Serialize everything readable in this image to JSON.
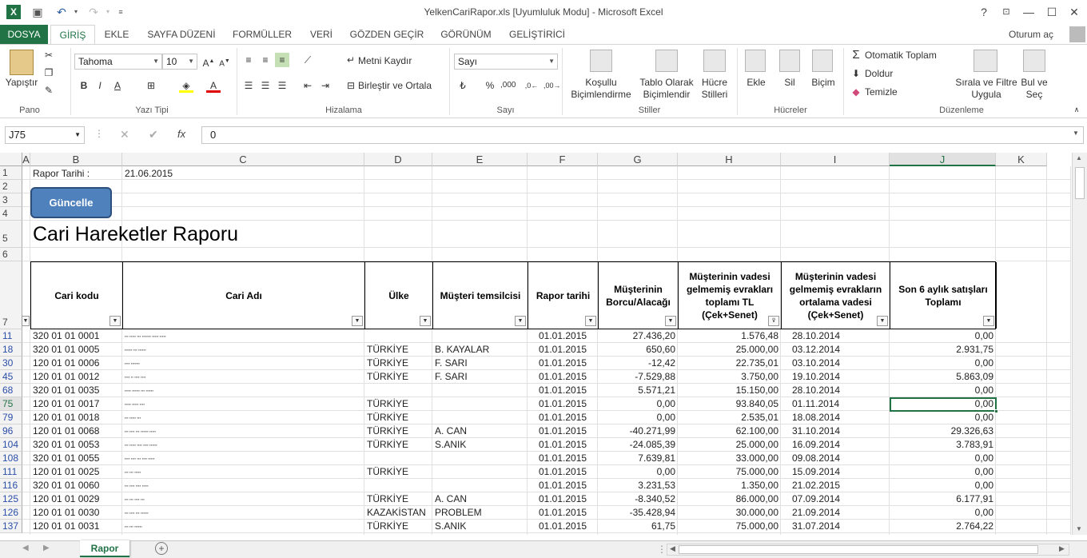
{
  "window": {
    "title": "YelkenCariRapor.xls  [Uyumluluk Modu] - Microsoft Excel",
    "help": "?",
    "user": "Oturum aç"
  },
  "tabs": [
    "DOSYA",
    "GİRİŞ",
    "EKLE",
    "SAYFA DÜZENİ",
    "FORMÜLLER",
    "VERİ",
    "GÖZDEN GEÇİR",
    "GÖRÜNÜM",
    "GELİŞTİRİCİ"
  ],
  "ribbon": {
    "paste": "Yapıştır",
    "pano": "Pano",
    "font_name": "Tahoma",
    "font_size": "10",
    "font_group": "Yazı Tipi",
    "wrap": "Metni Kaydır",
    "merge": "Birleştir ve Ortala",
    "align_group": "Hizalama",
    "number_format": "Sayı",
    "number_group": "Sayı",
    "cond1": "Koşullu",
    "cond2": "Biçimlendirme",
    "table1": "Tablo Olarak",
    "table2": "Biçimlendir",
    "cell1": "Hücre",
    "cell2": "Stilleri",
    "styles_group": "Stiller",
    "insert": "Ekle",
    "delete": "Sil",
    "format": "Biçim",
    "cells_group": "Hücreler",
    "autosum": "Otomatik Toplam",
    "fill": "Doldur",
    "clear": "Temizle",
    "sort1": "Sırala ve Filtre",
    "sort2": "Uygula",
    "find1": "Bul ve",
    "find2": "Seç",
    "edit_group": "Düzenleme"
  },
  "formula": {
    "namebox": "J75",
    "fx": "fx",
    "value": "0"
  },
  "columns": [
    "A",
    "B",
    "C",
    "D",
    "E",
    "F",
    "G",
    "H",
    "I",
    "J",
    "K"
  ],
  "sheet": {
    "report_date_label": "Rapor Tarihi :",
    "report_date": "21.06.2015",
    "button": "Güncelle",
    "title": "Cari Hareketler Raporu",
    "headers": [
      "Cari kodu",
      "Cari Adı",
      "Ülke",
      "Müşteri temsilcisi",
      "Rapor tarihi",
      "Müşterinin Borcu/Alacağı",
      "Müşterinin vadesi gelmemiş evrakları toplamı TL (Çek+Senet)",
      "Müşterinin vadesi gelmemiş evrakların ortalama vadesi (Çek+Senet)",
      "Son 6 aylık satışları Toplamı"
    ],
    "top_rows": [
      "1",
      "2",
      "3",
      "4",
      "5",
      "6",
      "7"
    ],
    "rows": [
      {
        "n": "11",
        "code": "320 01 01 0001",
        "name": "▪▪▪ ▪▪▪▪▪ ▪▪▪ ▪▪▪▪▪▪▪ ▪▪▪▪▪ ▪▪▪▪▪",
        "country": "",
        "rep": "",
        "date": "01.01.2015",
        "bal": "27.436,20",
        "tl": "1.576,48",
        "avg": "28.10.2014",
        "sales": "0,00"
      },
      {
        "n": "18",
        "code": "320 01 01 0005",
        "name": "▪▪▪▪▪▪ ▪▪▪ ▪▪▪▪▪▪",
        "country": "TÜRKİYE",
        "rep": "B. KAYALAR",
        "date": "01.01.2015",
        "bal": "650,60",
        "tl": "25.000,00",
        "avg": "03.12.2014",
        "sales": "2.931,75"
      },
      {
        "n": "30",
        "code": "120 01 01 0006",
        "name": "▪▪▪▪ ▪▪▪▪▪▪▪",
        "country": "TÜRKİYE",
        "rep": "F. SARI",
        "date": "01.01.2015",
        "bal": "-12,42",
        "tl": "22.735,01",
        "avg": "03.10.2014",
        "sales": "0,00"
      },
      {
        "n": "45",
        "code": "120 01 01 0012",
        "name": "▪▪▪▪ ▪▪ ▪▪▪▪ ▪▪▪▪",
        "country": "TÜRKİYE",
        "rep": "F. SARI",
        "date": "01.01.2015",
        "bal": "-7.529,88",
        "tl": "3.750,00",
        "avg": "19.10.2014",
        "sales": "5.863,09"
      },
      {
        "n": "68",
        "code": "320 01 01 0035",
        "name": "▪▪▪▪▪ ▪▪▪▪▪▪ ▪▪▪ ▪▪▪▪▪▪",
        "country": "",
        "rep": "",
        "date": "01.01.2015",
        "bal": "5.571,21",
        "tl": "15.150,00",
        "avg": "28.10.2014",
        "sales": "0,00"
      },
      {
        "n": "75",
        "code": "120 01 01 0017",
        "name": "▪▪▪▪▪ ▪▪▪▪▪ ▪▪▪▪",
        "country": "TÜRKİYE",
        "rep": "",
        "date": "01.01.2015",
        "bal": "0,00",
        "tl": "93.840,05",
        "avg": "01.11.2014",
        "sales": "0,00"
      },
      {
        "n": "79",
        "code": "120 01 01 0018",
        "name": "▪▪▪ ▪▪▪▪▪ ▪▪▪",
        "country": "TÜRKİYE",
        "rep": "",
        "date": "01.01.2015",
        "bal": "0,00",
        "tl": "2.535,01",
        "avg": "18.08.2014",
        "sales": "0,00"
      },
      {
        "n": "96",
        "code": "120 01 01 0068",
        "name": "▪▪▪ ▪▪▪▪ ▪▪▪ ▪▪▪▪▪▪ ▪▪▪▪▪",
        "country": "TÜRKİYE",
        "rep": "A. CAN",
        "date": "01.01.2015",
        "bal": "-40.271,99",
        "tl": "62.100,00",
        "avg": "31.10.2014",
        "sales": "29.326,63"
      },
      {
        "n": "104",
        "code": "320 01 01 0053",
        "name": "▪▪▪ ▪▪▪▪▪ ▪▪▪▪ ▪▪▪▪ ▪▪▪▪▪▪",
        "country": "TÜRKİYE",
        "rep": "S.ANIK",
        "date": "01.01.2015",
        "bal": "-24.085,39",
        "tl": "25.000,00",
        "avg": "16.09.2014",
        "sales": "3.783,91"
      },
      {
        "n": "108",
        "code": "320 01 01 0055",
        "name": "▪▪▪▪ ▪▪▪▪ ▪▪▪ ▪▪▪▪ ▪▪▪▪▪",
        "country": "",
        "rep": "",
        "date": "01.01.2015",
        "bal": "7.639,81",
        "tl": "33.000,00",
        "avg": "09.08.2014",
        "sales": "0,00"
      },
      {
        "n": "111",
        "code": "120 01 01 0025",
        "name": "▪▪▪ ▪▪▪ ▪▪▪▪▪",
        "country": "TÜRKİYE",
        "rep": "",
        "date": "01.01.2015",
        "bal": "0,00",
        "tl": "75.000,00",
        "avg": "15.09.2014",
        "sales": "0,00"
      },
      {
        "n": "116",
        "code": "320 01 01 0060",
        "name": "▪▪▪ ▪▪▪▪ ▪▪▪▪ ▪▪▪▪▪",
        "country": "",
        "rep": "",
        "date": "01.01.2015",
        "bal": "3.231,53",
        "tl": "1.350,00",
        "avg": "21.02.2015",
        "sales": "0,00"
      },
      {
        "n": "125",
        "code": "120 01 01 0029",
        "name": "▪▪▪ ▪▪▪ ▪▪▪▪ ▪▪▪",
        "country": "TÜRKİYE",
        "rep": "A. CAN",
        "date": "01.01.2015",
        "bal": "-8.340,52",
        "tl": "86.000,00",
        "avg": "07.09.2014",
        "sales": "6.177,91"
      },
      {
        "n": "126",
        "code": "120 01 01 0030",
        "name": "▪▪▪ ▪▪▪▪ ▪▪▪ ▪▪▪▪▪▪",
        "country": "KAZAKİSTAN",
        "rep": "PROBLEM",
        "date": "01.01.2015",
        "bal": "-35.428,94",
        "tl": "30.000,00",
        "avg": "21.09.2014",
        "sales": "0,00"
      },
      {
        "n": "137",
        "code": "120 01 01 0031",
        "name": "▪▪▪ ▪▪▪ ▪▪▪▪▪▪",
        "country": "TÜRKİYE",
        "rep": "S.ANIK",
        "date": "01.01.2015",
        "bal": "61,75",
        "tl": "75.000,00",
        "avg": "31.07.2014",
        "sales": "2.764,22"
      }
    ]
  },
  "sheet_tab": "Rapor"
}
